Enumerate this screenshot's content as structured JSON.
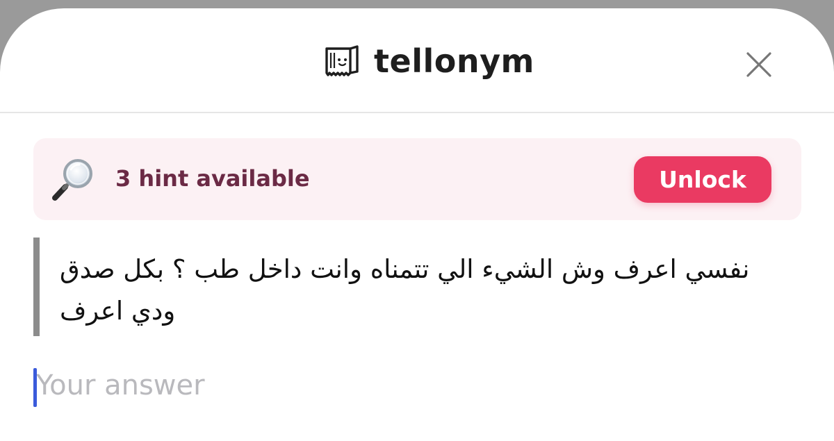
{
  "header": {
    "brand_name": "tellonym",
    "brand_icon": "tellonym-logo-icon",
    "close_icon": "close-icon"
  },
  "hint": {
    "icon": "magnifying-glass-icon",
    "text": "3 hint available",
    "unlock_label": "Unlock"
  },
  "message": {
    "text": "نفسي اعرف وش الشيء الي تتمناه وانت داخل طب ؟ بكل صدق ودي اعرف"
  },
  "answer": {
    "value": "",
    "placeholder": "Your answer"
  },
  "colors": {
    "accent": "#ea3a62",
    "hint_background": "#fcf1f4",
    "hint_text": "#6b2a45",
    "caret": "#3b5bdb"
  }
}
